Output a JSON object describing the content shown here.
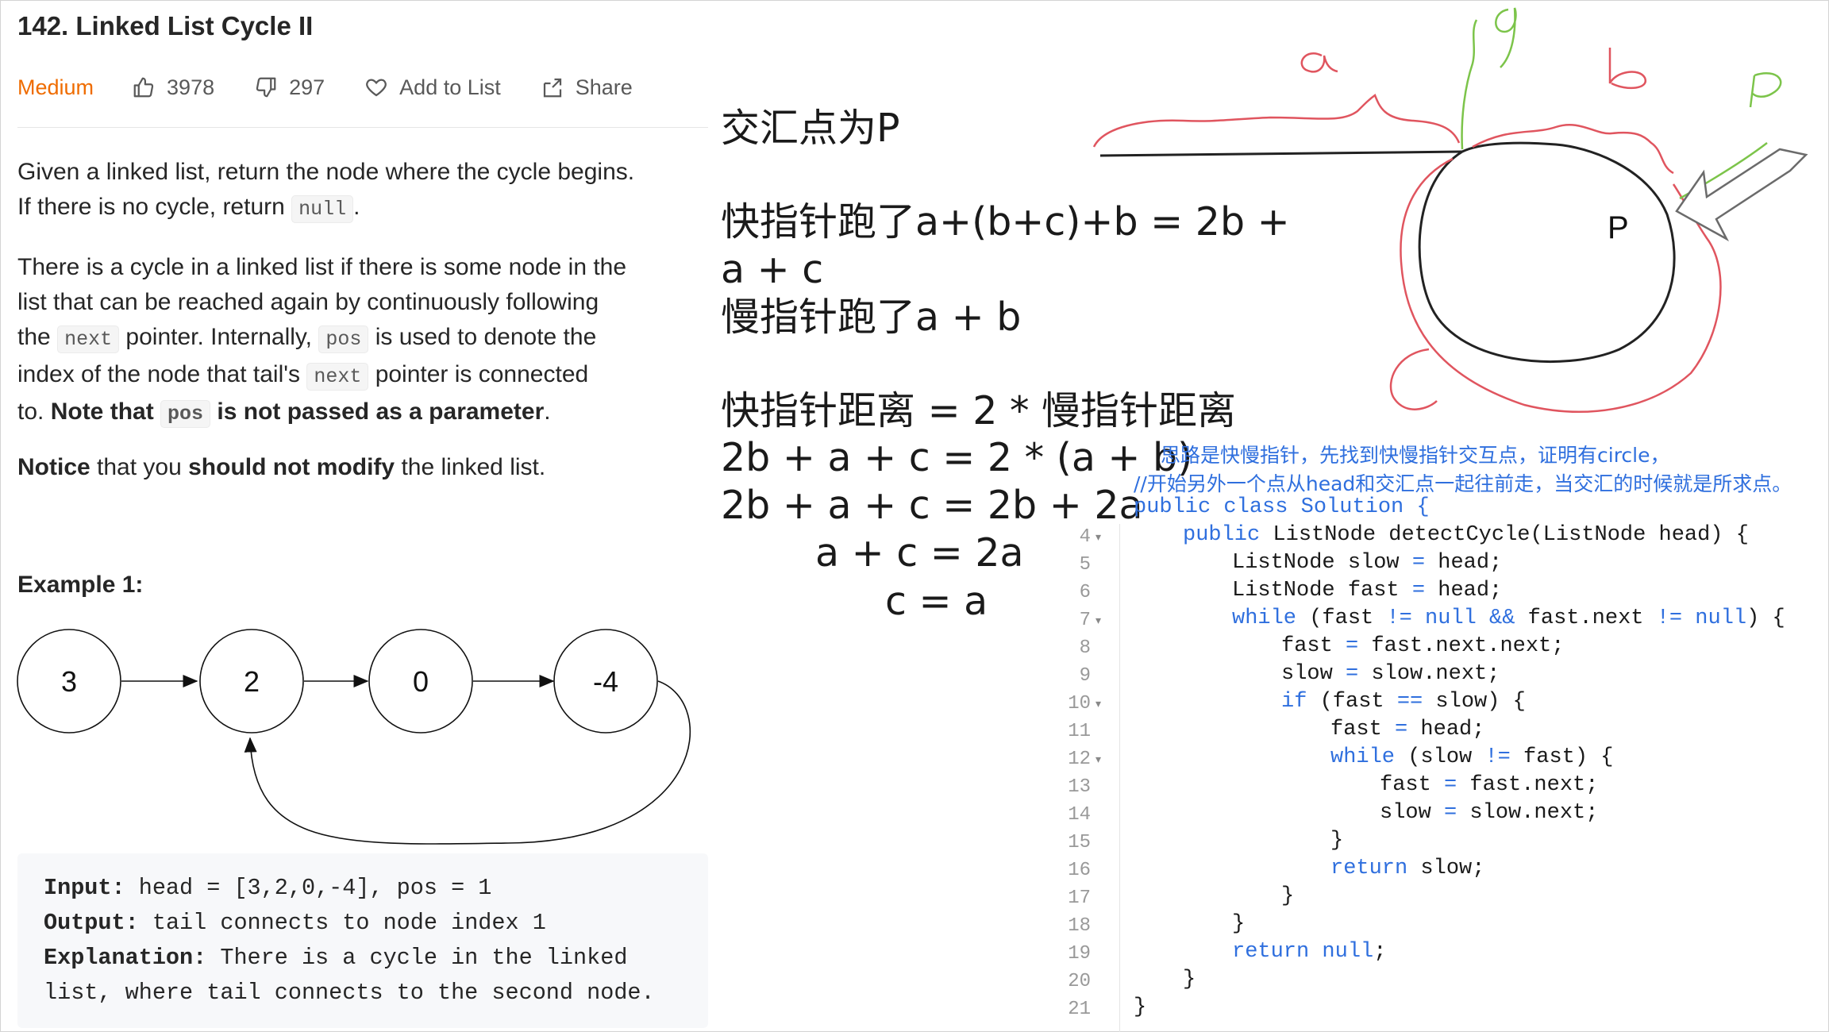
{
  "problem": {
    "title": "142. Linked List Cycle II",
    "difficulty": "Medium",
    "likes": "3978",
    "dislikes": "297",
    "add_to_list": "Add to List",
    "share": "Share",
    "para1_a": "Given a linked list, return the node where the cycle begins.",
    "para1_b": "If there is no cycle, return",
    "para1_code": "null",
    "para1_end": ".",
    "para2_l1": "There is a cycle in a linked list if there is some node in the",
    "para2_l2": "list that can be reached again by continuously following",
    "para2_l3a": "the",
    "code_next": "next",
    "para2_l3b": "pointer. Internally,",
    "code_pos": "pos",
    "para2_l3c": "is used to denote the",
    "para2_l4a": "index of the node that tail's",
    "para2_l4b": "pointer is connected",
    "para2_l5a": "to.",
    "para2_bold1": "Note that",
    "para2_bold2": "is not passed as a parameter",
    "para2_end": ".",
    "para3_bold1": "Notice",
    "para3_a": "that you",
    "para3_bold2": "should not modify",
    "para3_b": "the linked list.",
    "example_title": "Example 1:",
    "nodes": [
      "3",
      "2",
      "0",
      "-4"
    ],
    "ex_input_label": "Input:",
    "ex_input": " head = [3,2,0,-4], pos = 1",
    "ex_output_label": "Output:",
    "ex_output": " tail connects to node index 1",
    "ex_expl_label": "Explanation:",
    "ex_expl_1": " There is a cycle in the linked",
    "ex_expl_2": "list, where tail connects to the second node."
  },
  "notes": {
    "line1": "交汇点为P",
    "line2": "快指针跑了a+(b+c)+b = 2b +",
    "line3": "a + c",
    "line4": "慢指针跑了a + b",
    "line5": "快指针距离 = 2 * 慢指针距离",
    "line6": "2b + a + c = 2 * (a + b)",
    "line7": "2b + a + c = 2b + 2a",
    "line8": "a + c = 2a",
    "line9": "c = a"
  },
  "drawing": {
    "label_a": "a",
    "label_g": "g",
    "label_b": "b",
    "label_p_green": "p",
    "label_P": "P",
    "label_c": "c"
  },
  "editor": {
    "comment1": "思路是快慢指针，先找到快慢指针交互点，证明有circle，",
    "comment2": "//开始另外一个点从head和交汇点一起往前走，当交汇的时候就是所求点。",
    "line3": "public class Solution {",
    "lines": [
      {
        "n": "4",
        "fold": true
      },
      {
        "n": "5",
        "fold": false
      },
      {
        "n": "6",
        "fold": false
      },
      {
        "n": "7",
        "fold": true
      },
      {
        "n": "8",
        "fold": false
      },
      {
        "n": "9",
        "fold": false
      },
      {
        "n": "10",
        "fold": true
      },
      {
        "n": "11",
        "fold": false
      },
      {
        "n": "12",
        "fold": true
      },
      {
        "n": "13",
        "fold": false
      },
      {
        "n": "14",
        "fold": false
      },
      {
        "n": "15",
        "fold": false
      },
      {
        "n": "16",
        "fold": false
      },
      {
        "n": "17",
        "fold": false
      },
      {
        "n": "18",
        "fold": false
      },
      {
        "n": "19",
        "fold": false
      },
      {
        "n": "20",
        "fold": false
      },
      {
        "n": "21",
        "fold": false
      }
    ],
    "code": {
      "l4_kw": "public",
      "l4_rest": " ListNode detectCycle(ListNode head) {",
      "l5": "ListNode slow ",
      "l5_op": "=",
      "l5_end": " head;",
      "l6": "ListNode fast ",
      "l6_op": "=",
      "l6_end": " head;",
      "l7_kw": "while",
      "l7_a": " (fast ",
      "l7_op1": "!=",
      "l7_null1": " null",
      "l7_and": " &&",
      "l7_b": " fast.next ",
      "l7_op2": "!=",
      "l7_null2": " null",
      "l7_end": ") {",
      "l8": "fast ",
      "l8_op": "=",
      "l8_end": " fast.next.next;",
      "l9": "slow ",
      "l9_op": "=",
      "l9_end": " slow.next;",
      "l10_kw": "if",
      "l10_a": " (fast ",
      "l10_op": "==",
      "l10_end": " slow) {",
      "l11": "fast ",
      "l11_op": "=",
      "l11_end": " head;",
      "l12_kw": "while",
      "l12_a": " (slow ",
      "l12_op": "!=",
      "l12_end": " fast) {",
      "l13": "fast ",
      "l13_op": "=",
      "l13_end": " fast.next;",
      "l14": "slow ",
      "l14_op": "=",
      "l14_end": " slow.next;",
      "l15": "}",
      "l16_kw": "return",
      "l16_end": " slow;",
      "l17": "}",
      "l18": "}",
      "l19_kw": "return",
      "l19_null": " null",
      "l19_end": ";",
      "l20": "}",
      "l21": "}"
    }
  },
  "colors": {
    "difficulty": "#ef6c00",
    "keyword": "#2f6fde",
    "comment": "#2f6fde",
    "ink_red": "#e0555f",
    "ink_green": "#7cc44a"
  }
}
